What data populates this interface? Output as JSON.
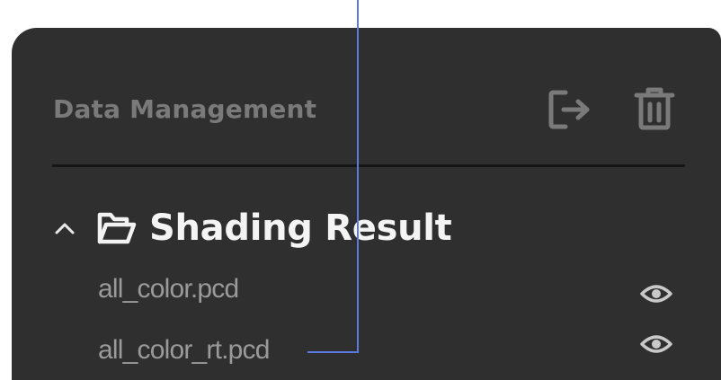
{
  "panel": {
    "title": "Data Management",
    "header_icons": [
      "export-icon",
      "trash-icon"
    ],
    "group": {
      "label": "Shading Result",
      "expanded": true,
      "files": [
        {
          "name": "all_color.pcd",
          "visible": true,
          "action_icon": "eye-icon"
        },
        {
          "name": "all_color_rt.pcd",
          "visible": true,
          "action_icon": "eye-icon"
        }
      ]
    }
  },
  "colors": {
    "panel_bg": "#2f2f2f",
    "muted_text": "#7a7a7a",
    "accent_line": "#5b7be0"
  }
}
